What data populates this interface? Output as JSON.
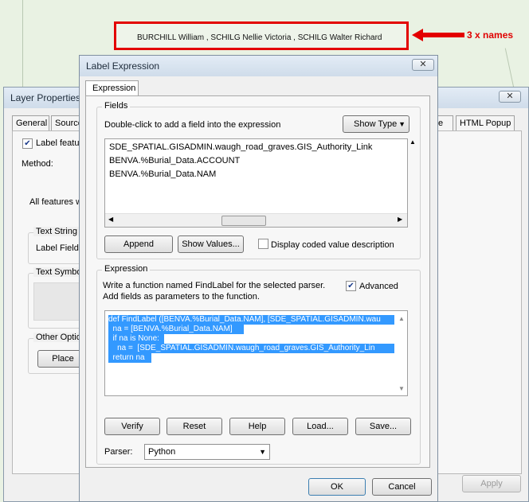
{
  "map_label": "BURCHILL William , SCHILG Nellie Victoria , SCHILG Walter Richard",
  "callout": "3 x names",
  "layer_properties": {
    "title": "Layer Properties",
    "close": "✕",
    "tabs": [
      "General",
      "Source",
      "e",
      "HTML Popup"
    ],
    "label_features": "Label featur",
    "method_label": "Method:",
    "all_features": "All features w",
    "text_string": "Text String",
    "label_field": "Label Field:",
    "text_symbol": "Text Symbo",
    "other_options": "Other Optio",
    "place_button": "Place",
    "apply_button": "Apply"
  },
  "label_expression": {
    "title": "Label Expression",
    "close": "✕",
    "tab": "Expression",
    "fields_group": "Fields",
    "fields_hint": "Double-click to add a field into the expression",
    "show_type": "Show Type",
    "fields": [
      "SDE_SPATIAL.GISADMIN.waugh_road_graves.GIS_Authority_Link",
      "BENVA.%Burial_Data.ACCOUNT",
      "BENVA.%Burial_Data.NAM"
    ],
    "append": "Append",
    "show_values": "Show Values...",
    "display_coded": "Display coded value description",
    "expression_group": "Expression",
    "expr_hint_1": "Write a function named FindLabel for the selected parser.",
    "expr_hint_2": "Add fields as parameters to the function.",
    "advanced": "Advanced",
    "code": [
      "def FindLabel ([BENVA.%Burial_Data.NAM], [SDE_SPATIAL.GISADMIN.wau",
      "  na = [BENVA.%Burial_Data.NAM]",
      "  if na is None:",
      "    na =  [SDE_SPATIAL.GISADMIN.waugh_road_graves.GIS_Authority_Lin",
      "  return na"
    ],
    "verify": "Verify",
    "reset": "Reset",
    "help": "Help",
    "load": "Load...",
    "save": "Save...",
    "parser_label": "Parser:",
    "parser_value": "Python",
    "ok": "OK",
    "cancel": "Cancel"
  }
}
